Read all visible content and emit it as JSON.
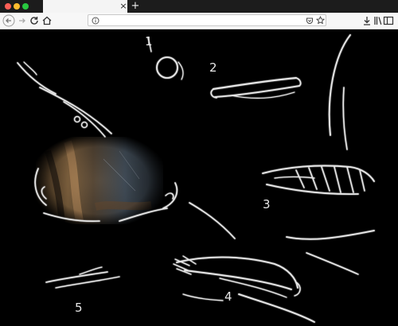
{
  "browser": {
    "tab": {
      "title": "",
      "close_glyph": "×"
    },
    "new_tab_glyph": "+",
    "url": "",
    "colors": {
      "close": "#ff5f57",
      "minimize": "#febc2e",
      "maximize": "#28c840",
      "ink": "#e8e8e8"
    }
  },
  "toolbar_icons": [
    "back-icon",
    "forward-icon",
    "reload-icon",
    "home-icon",
    "info-icon",
    "pocket-icon",
    "bookmark-star-icon",
    "download-icon",
    "library-icon",
    "sidebar-icon",
    "menu-icon"
  ],
  "canvas": {
    "labels": [
      "1",
      "2",
      "3",
      "4",
      "5"
    ],
    "photo_description_hidden": ""
  }
}
